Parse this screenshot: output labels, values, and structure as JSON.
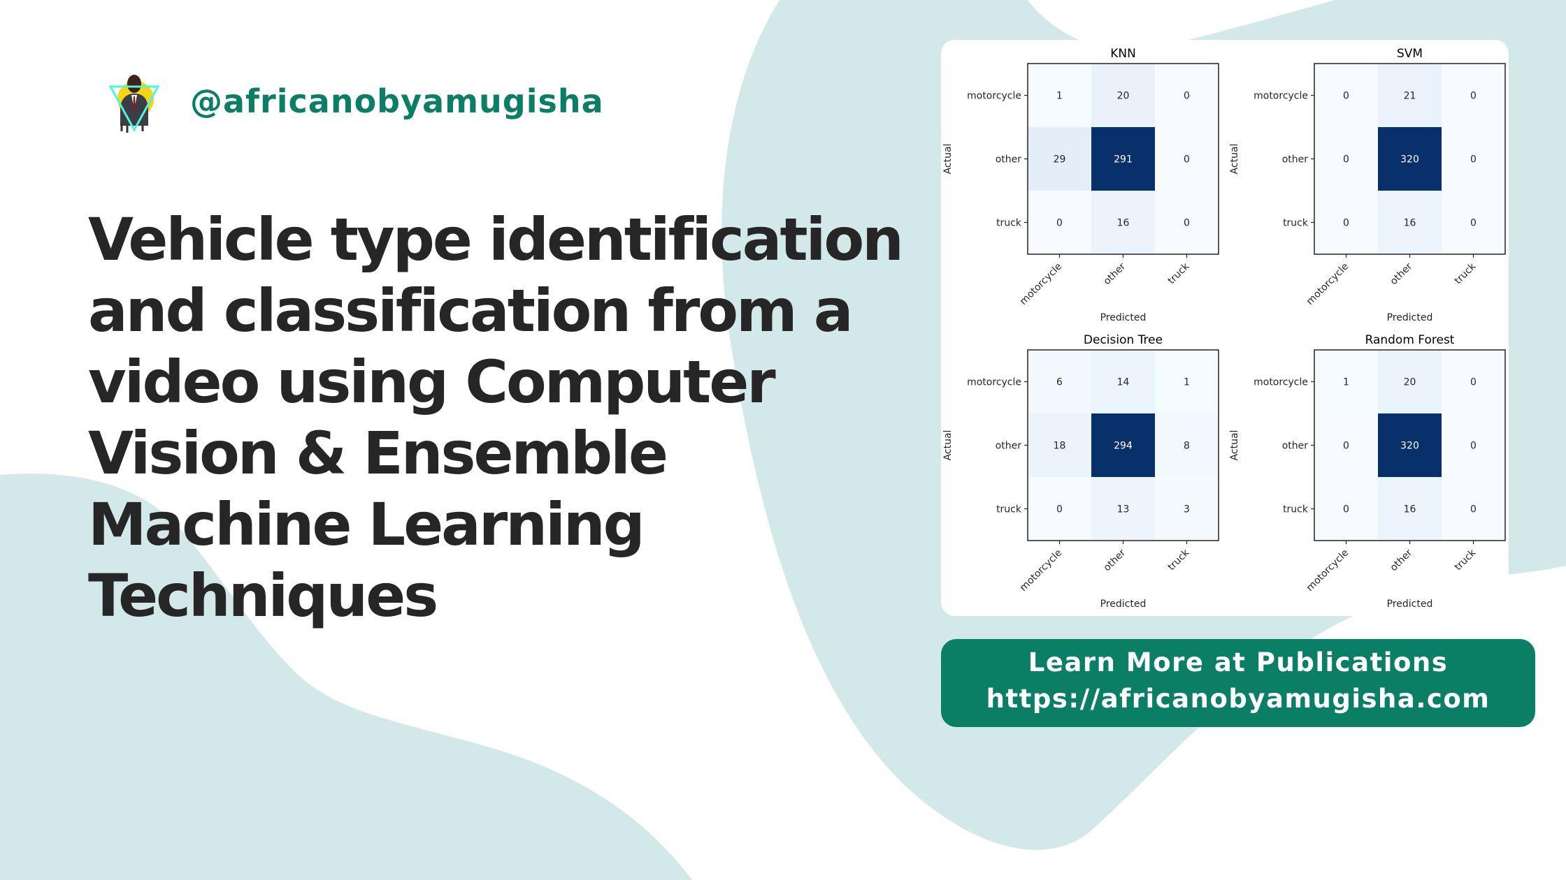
{
  "brand": {
    "handle": "@africanobyamugisha",
    "avatar_icon": "profile-portrait-icon"
  },
  "title_lines": [
    "Vehicle type identification",
    "and classification from a",
    "video using Computer",
    "Vision & Ensemble",
    "Machine Learning",
    "Techniques"
  ],
  "cta": {
    "line1": "Learn More at Publications",
    "line2": "https://africanobyamugisha.com"
  },
  "colors": {
    "accent": "#0b7e66",
    "blob": "#d3e8e9",
    "title_text": "#262626",
    "heatmap_low": "#f7fbff",
    "heatmap_high": "#08306b"
  },
  "chart_data": [
    {
      "type": "heatmap",
      "title": "KNN",
      "xlabel": "Predicted",
      "ylabel": "Actual",
      "x_categories": [
        "motorcycle",
        "other",
        "truck"
      ],
      "y_categories": [
        "motorcycle",
        "other",
        "truck"
      ],
      "values": [
        [
          1,
          20,
          0
        ],
        [
          29,
          291,
          0
        ],
        [
          0,
          16,
          0
        ]
      ],
      "colormap": "Blues"
    },
    {
      "type": "heatmap",
      "title": "SVM",
      "xlabel": "Predicted",
      "ylabel": "Actual",
      "x_categories": [
        "motorcycle",
        "other",
        "truck"
      ],
      "y_categories": [
        "motorcycle",
        "other",
        "truck"
      ],
      "values": [
        [
          0,
          21,
          0
        ],
        [
          0,
          320,
          0
        ],
        [
          0,
          16,
          0
        ]
      ],
      "colormap": "Blues"
    },
    {
      "type": "heatmap",
      "title": "Decision Tree",
      "xlabel": "Predicted",
      "ylabel": "Actual",
      "x_categories": [
        "motorcycle",
        "other",
        "truck"
      ],
      "y_categories": [
        "motorcycle",
        "other",
        "truck"
      ],
      "values": [
        [
          6,
          14,
          1
        ],
        [
          18,
          294,
          8
        ],
        [
          0,
          13,
          3
        ]
      ],
      "colormap": "Blues"
    },
    {
      "type": "heatmap",
      "title": "Random Forest",
      "xlabel": "Predicted",
      "ylabel": "Actual",
      "x_categories": [
        "motorcycle",
        "other",
        "truck"
      ],
      "y_categories": [
        "motorcycle",
        "other",
        "truck"
      ],
      "values": [
        [
          1,
          20,
          0
        ],
        [
          0,
          320,
          0
        ],
        [
          0,
          16,
          0
        ]
      ],
      "colormap": "Blues"
    }
  ]
}
